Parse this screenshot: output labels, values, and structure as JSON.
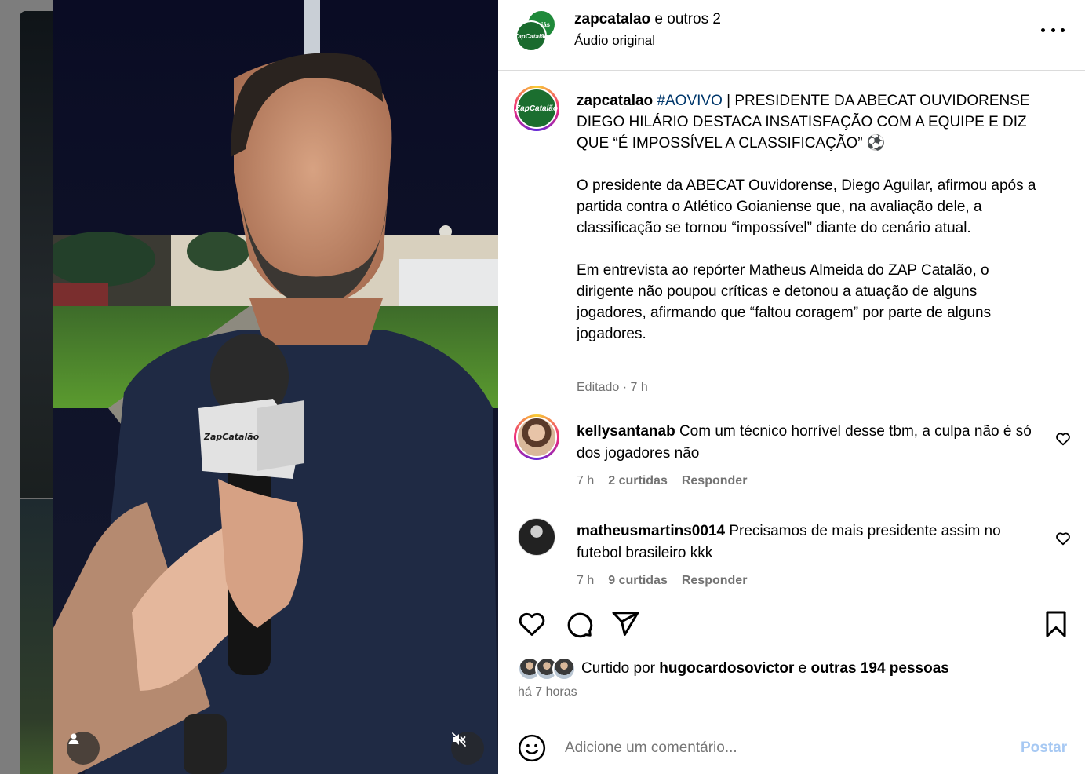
{
  "post": {
    "header": {
      "username": "zapcatalao",
      "coauthors": " e outros 2",
      "audio": "Áudio original",
      "avatar_text_a": "Goiás",
      "avatar_text_b": "ZapCatalão"
    },
    "caption": {
      "username": "zapcatalao",
      "hashtag": "#AOVIVO",
      "headline": " | PRESIDENTE DA ABECAT OUVIDORENSE DIEGO HILÁRIO DESTACA INSATISFAÇÃO COM A EQUIPE E DIZ QUE “É IMPOSSÍVEL A CLASSIFICAÇÃO” ⚽",
      "paragraph1": "O presidente da ABECAT Ouvidorense, Diego Aguilar, afirmou após a partida contra o Atlético Goianiense que, na avaliação dele, a classificação se tornou “impossível” diante do cenário atual.",
      "paragraph2": "Em entrevista ao repórter Matheus Almeida do ZAP Catalão, o dirigente não poupou críticas e detonou a atuação de alguns jogadores, afirmando que “faltou coragem” por parte de alguns jogadores.",
      "meta": "Editado · 7 h"
    },
    "comments": [
      {
        "username": "kellysantanab",
        "text": " Com um técnico horrível desse tbm, a culpa não é só dos jogadores não",
        "time": "7 h",
        "likes": "2 curtidas",
        "reply": "Responder"
      },
      {
        "username": "matheusmartins0014",
        "text": " Precisamos de mais presidente assim no futebol brasileiro kkk",
        "time": "7 h",
        "likes": "9 curtidas",
        "reply": "Responder"
      }
    ],
    "likes": {
      "prefix": "Curtido por ",
      "user": "hugocardosovictor",
      "middle": " e ",
      "others": "outras 194 pessoas"
    },
    "time_ago": "há 7 horas",
    "comment_box": {
      "placeholder": "Adicione um comentário...",
      "post_label": "Postar"
    },
    "media": {
      "mic_logo": "ZapCatalão"
    }
  }
}
